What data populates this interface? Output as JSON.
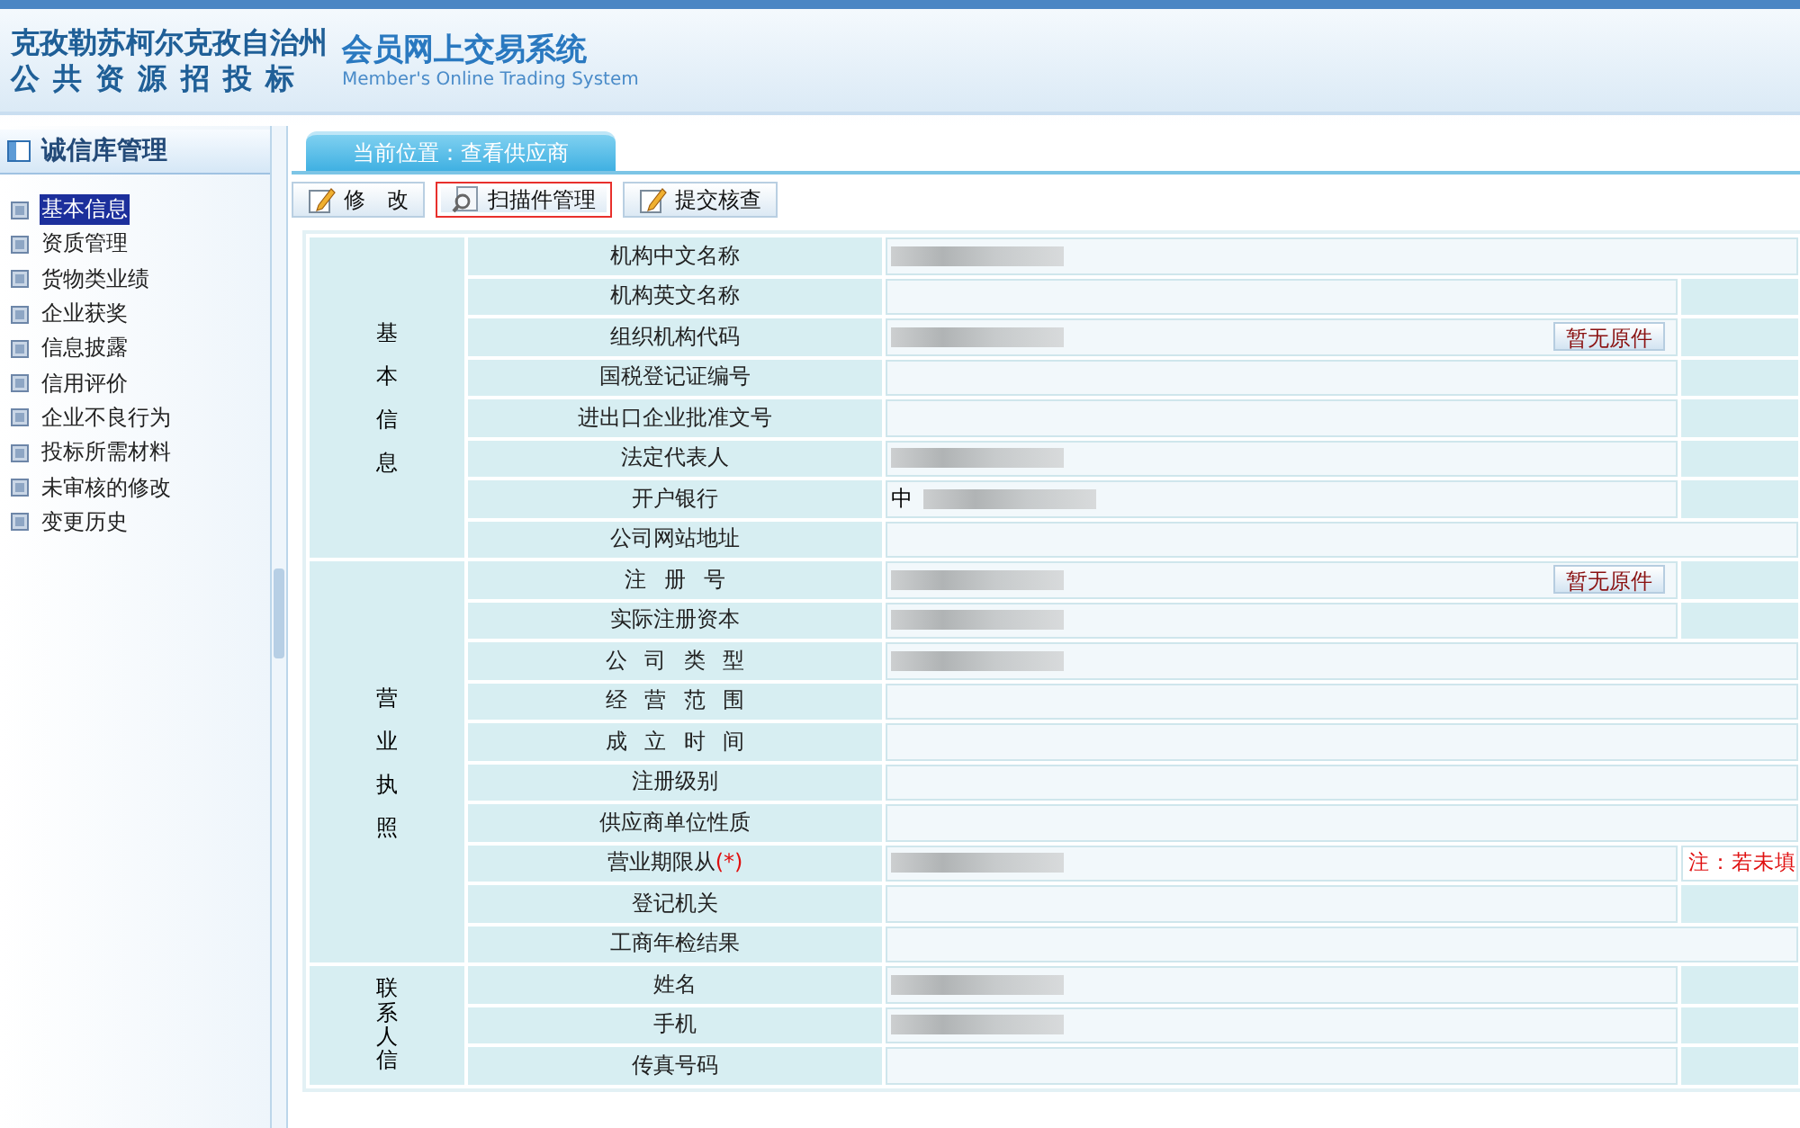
{
  "header": {
    "region": "克孜勒苏柯尔克孜自治州",
    "org": "公 共 资 源 招 投 标",
    "system": "会员网上交易系统",
    "system_en": "Member's Online Trading System"
  },
  "sidebar": {
    "title": "诚信库管理",
    "items": [
      {
        "label": "基本信息",
        "selected": true
      },
      {
        "label": "资质管理",
        "selected": false
      },
      {
        "label": "货物类业绩",
        "selected": false
      },
      {
        "label": "企业获奖",
        "selected": false
      },
      {
        "label": "信息披露",
        "selected": false
      },
      {
        "label": "信用评价",
        "selected": false
      },
      {
        "label": "企业不良行为",
        "selected": false
      },
      {
        "label": "投标所需材料",
        "selected": false
      },
      {
        "label": "未审核的修改",
        "selected": false
      },
      {
        "label": "变更历史",
        "selected": false
      }
    ]
  },
  "breadcrumb": "当前位置：查看供应商",
  "toolbar": [
    {
      "label": "修 改",
      "kind": "edit",
      "highlighted": false
    },
    {
      "label": "扫描件管理",
      "kind": "scan",
      "highlighted": true
    },
    {
      "label": "提交核查",
      "kind": "edit",
      "highlighted": false
    }
  ],
  "groups": [
    {
      "label": "基本信息",
      "rows": [
        {
          "label": "机构中文名称",
          "redacted": true,
          "side_cell": false
        },
        {
          "label": "机构英文名称",
          "redacted": false,
          "side_cell": true
        },
        {
          "label": "组织机构代码",
          "redacted": true,
          "button": "暂无原件",
          "side_cell": true
        },
        {
          "label": "国税登记证编号",
          "redacted": false,
          "side_cell": true
        },
        {
          "label": "进出口企业批准文号",
          "redacted": false,
          "side_cell": true
        },
        {
          "label": "法定代表人",
          "redacted": true,
          "side_cell": true
        },
        {
          "label": "开户银行",
          "value": "中",
          "redacted": true,
          "side_cell": true
        },
        {
          "label": "公司网站地址",
          "redacted": false,
          "side_cell": false
        }
      ]
    },
    {
      "label": "营业执照",
      "rows": [
        {
          "label": "注 册 号",
          "redacted": true,
          "button": "暂无原件",
          "side_cell": true
        },
        {
          "label": "实际注册资本",
          "redacted": true,
          "side_cell": true
        },
        {
          "label": "公 司 类 型",
          "redacted": true,
          "side_cell": false
        },
        {
          "label": "经 营 范 围",
          "redacted": false,
          "side_cell": false
        },
        {
          "label": "成 立 时 间",
          "redacted": false,
          "side_cell": false
        },
        {
          "label": "注册级别",
          "redacted": false,
          "side_cell": false
        },
        {
          "label": "供应商单位性质",
          "redacted": false,
          "side_cell": false
        },
        {
          "label": "营业期限从",
          "marker": "(*)",
          "redacted": true,
          "note": "注：若未填"
        },
        {
          "label": "登记机关",
          "redacted": false,
          "side_cell": true
        },
        {
          "label": "工商年检结果",
          "redacted": false,
          "side_cell": false
        }
      ]
    },
    {
      "label": "联系人信",
      "rows": [
        {
          "label": "姓名",
          "redacted": true,
          "side_cell": true
        },
        {
          "label": "手机",
          "redacted": true,
          "side_cell": true
        },
        {
          "label": "传真号码",
          "redacted": false,
          "side_cell": true
        }
      ]
    }
  ]
}
